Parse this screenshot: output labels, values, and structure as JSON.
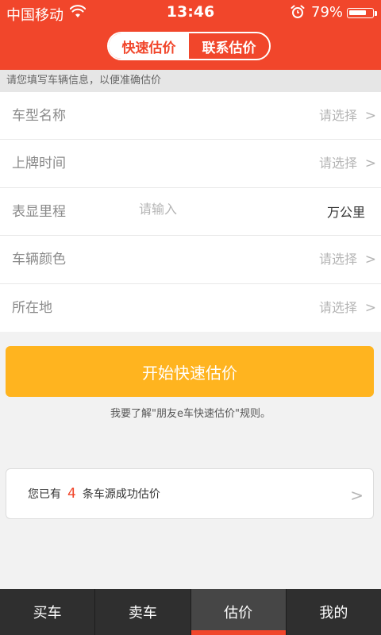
{
  "status_bar": {
    "carrier": "中国移动",
    "time": "13:46",
    "battery_text": "79%",
    "battery_level": 0.79,
    "icons": [
      "wifi-icon",
      "alarm-icon",
      "battery-icon"
    ]
  },
  "header": {
    "tabs": [
      {
        "label": "快速估价",
        "active": true
      },
      {
        "label": "联系估价",
        "active": false
      }
    ]
  },
  "hint": "请您填写车辆信息，以便准确估价",
  "form": {
    "rows": [
      {
        "label": "车型名称",
        "value": "请选择",
        "chevron": ">"
      },
      {
        "label": "上牌时间",
        "value": "请选择",
        "chevron": ">"
      },
      {
        "label": "表显里程",
        "placeholder": "请输入",
        "unit": "万公里"
      },
      {
        "label": "车辆颜色",
        "value": "请选择",
        "chevron": ">"
      },
      {
        "label": "所在地",
        "value": "请选择",
        "chevron": ">"
      }
    ]
  },
  "cta_label": "开始快速估价",
  "rules_link": "我要了解\"朋友e车快速估价\"规则。",
  "summary_card": {
    "prefix": "您已有",
    "count": "4",
    "suffix": "条车源成功估价",
    "chevron": ">"
  },
  "tabbar": {
    "items": [
      {
        "label": "买车",
        "active": false
      },
      {
        "label": "卖车",
        "active": false
      },
      {
        "label": "估价",
        "active": true
      },
      {
        "label": "我的",
        "active": false
      }
    ]
  },
  "colors": {
    "brand_red": "#f1462b",
    "cta_yellow": "#ffb41f",
    "tabbar_bg": "#2f2f2f"
  }
}
